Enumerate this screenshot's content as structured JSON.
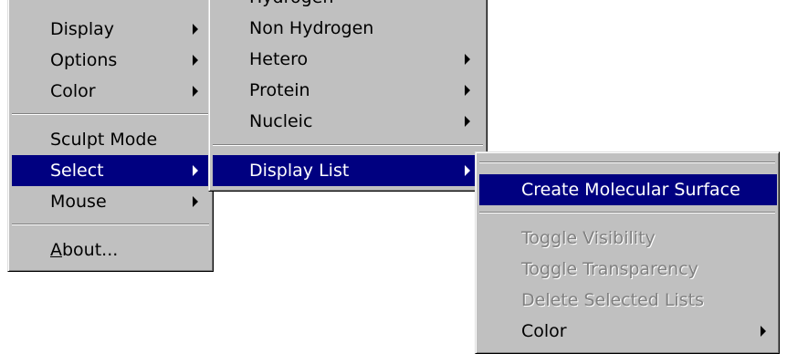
{
  "main_menu": {
    "items": [
      {
        "label": "Display",
        "submenu": true
      },
      {
        "label": "Options",
        "submenu": true
      },
      {
        "label": "Color",
        "submenu": true
      },
      {
        "label": "Sculpt Mode",
        "submenu": false
      },
      {
        "label": "Select",
        "submenu": true,
        "highlighted": true
      },
      {
        "label": "Mouse",
        "submenu": true
      },
      {
        "label_mnemonic": "A",
        "label_rest": "bout...",
        "submenu": false
      }
    ]
  },
  "select_menu": {
    "partial_top_label": "Hydrogen",
    "items": [
      {
        "label": "Non Hydrogen",
        "submenu": false
      },
      {
        "label": "Hetero",
        "submenu": true
      },
      {
        "label": "Protein",
        "submenu": true
      },
      {
        "label": "Nucleic",
        "submenu": true
      },
      {
        "label": "Display List",
        "submenu": true,
        "highlighted": true
      }
    ]
  },
  "display_list_menu": {
    "items": [
      {
        "label": "Create Molecular Surface",
        "highlighted": true,
        "enabled": true
      },
      {
        "label": "Toggle Visibility",
        "enabled": false
      },
      {
        "label": "Toggle Transparency",
        "enabled": false
      },
      {
        "label": "Delete Selected Lists",
        "enabled": false
      },
      {
        "label": "Color",
        "enabled": true,
        "submenu": true
      }
    ]
  },
  "colors": {
    "menu_bg": "#c0c0c0",
    "highlight_bg": "#000080",
    "highlight_text": "#ffffff",
    "disabled_text": "#808080"
  }
}
